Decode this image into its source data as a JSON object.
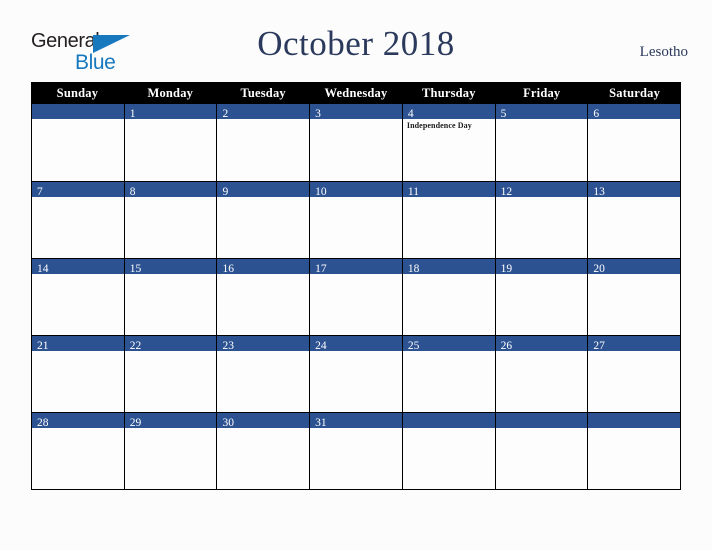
{
  "brand": {
    "name_top": "General",
    "name_bottom": "Blue",
    "triangle_icon": "blue-triangle-icon",
    "color_top": "#231f20",
    "color_bottom": "#1878be"
  },
  "header": {
    "title": "October 2018",
    "country": "Lesotho",
    "title_color": "#2b3a5c"
  },
  "theme": {
    "accent_blue": "#2d5291",
    "header_black": "#000000",
    "page_background": "#fdfcfc",
    "cell_background": "#fdfdfd"
  },
  "calendar": {
    "month": "October",
    "year": "2018",
    "weekday_headers": [
      "Sunday",
      "Monday",
      "Tuesday",
      "Wednesday",
      "Thursday",
      "Friday",
      "Saturday"
    ],
    "weeks": [
      [
        {
          "num": "",
          "event": ""
        },
        {
          "num": "1",
          "event": ""
        },
        {
          "num": "2",
          "event": ""
        },
        {
          "num": "3",
          "event": ""
        },
        {
          "num": "4",
          "event": "Independence Day"
        },
        {
          "num": "5",
          "event": ""
        },
        {
          "num": "6",
          "event": ""
        }
      ],
      [
        {
          "num": "7",
          "event": ""
        },
        {
          "num": "8",
          "event": ""
        },
        {
          "num": "9",
          "event": ""
        },
        {
          "num": "10",
          "event": ""
        },
        {
          "num": "11",
          "event": ""
        },
        {
          "num": "12",
          "event": ""
        },
        {
          "num": "13",
          "event": ""
        }
      ],
      [
        {
          "num": "14",
          "event": ""
        },
        {
          "num": "15",
          "event": ""
        },
        {
          "num": "16",
          "event": ""
        },
        {
          "num": "17",
          "event": ""
        },
        {
          "num": "18",
          "event": ""
        },
        {
          "num": "19",
          "event": ""
        },
        {
          "num": "20",
          "event": ""
        }
      ],
      [
        {
          "num": "21",
          "event": ""
        },
        {
          "num": "22",
          "event": ""
        },
        {
          "num": "23",
          "event": ""
        },
        {
          "num": "24",
          "event": ""
        },
        {
          "num": "25",
          "event": ""
        },
        {
          "num": "26",
          "event": ""
        },
        {
          "num": "27",
          "event": ""
        }
      ],
      [
        {
          "num": "28",
          "event": ""
        },
        {
          "num": "29",
          "event": ""
        },
        {
          "num": "30",
          "event": ""
        },
        {
          "num": "31",
          "event": ""
        },
        {
          "num": "",
          "event": ""
        },
        {
          "num": "",
          "event": ""
        },
        {
          "num": "",
          "event": ""
        }
      ]
    ]
  }
}
